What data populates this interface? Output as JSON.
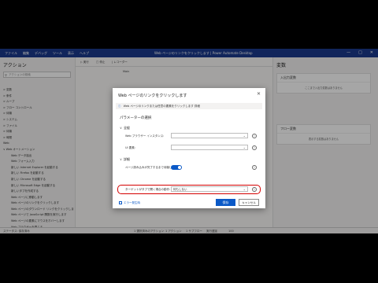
{
  "titlebar": {
    "menu": [
      "ファイル",
      "編集",
      "デバッグ",
      "ツール",
      "表示",
      "ヘルプ"
    ],
    "title": "Web ページのリンクをクリックします | Power Automate Desktop",
    "controls": [
      "—",
      "□",
      "✕"
    ]
  },
  "left_panel": {
    "title": "アクション",
    "search_placeholder": "アクションの検索",
    "items": [
      {
        "label": "> 変数",
        "level": "cat"
      },
      {
        "label": "> 条件",
        "level": "cat"
      },
      {
        "label": "> ループ",
        "level": "cat"
      },
      {
        "label": "> フロー コントロール",
        "level": "cat"
      },
      {
        "label": "> 待機",
        "level": "cat"
      },
      {
        "label": "> システム",
        "level": "cat"
      },
      {
        "label": "> ファイル",
        "level": "cat"
      },
      {
        "label": "> 待機",
        "level": "cat"
      },
      {
        "label": "> 時間",
        "level": "cat"
      },
      {
        "label": "Web",
        "level": "cat"
      },
      {
        "label": "∨ Web オートメーション",
        "level": "cat"
      },
      {
        "label": "Web データ抽出",
        "level": "sub"
      },
      {
        "label": "Web フォーム入力",
        "level": "sub"
      },
      {
        "label": "新しい Internet Explorer を起動する",
        "level": "sub"
      },
      {
        "label": "新しい Firefox を起動する",
        "level": "sub"
      },
      {
        "label": "新しい Chrome を起動する",
        "level": "sub"
      },
      {
        "label": "新しい Microsoft Edge を起動する",
        "level": "sub"
      },
      {
        "label": "新しいタブを作成する",
        "level": "sub"
      },
      {
        "label": "Web ページに移動します",
        "level": "sub"
      },
      {
        "label": "Web ページのリンクをクリックします",
        "level": "sub"
      },
      {
        "label": "Web ページのダウンロード リンクをクリックします",
        "level": "sub"
      },
      {
        "label": "Web ページで JavaScript 関数を実行します",
        "level": "sub"
      },
      {
        "label": "Web ページの要素にマウスをホバーします",
        "level": "sub"
      },
      {
        "label": "Web ブラウザーを閉じる",
        "level": "sub"
      },
      {
        "label": "Excel",
        "level": "cat"
      },
      {
        "label": "> データベース",
        "level": "cat"
      }
    ]
  },
  "center": {
    "toolbar": [
      "▷ 実行",
      "□ 停止",
      "| レコーダー",
      "Main"
    ]
  },
  "right_panel": {
    "title": "変数",
    "input_output": {
      "header": "入出力変数",
      "text": "ここまで入出力変数はありません"
    },
    "flow": {
      "header": "フロー変数",
      "text": "表示する変数はありません"
    }
  },
  "statusbar": {
    "left": "ステータス: 保存済み",
    "mid": [
      "1 選択済みのアクション",
      "1 アクション",
      "1 サブフロー"
    ],
    "right": "実行遅延",
    "delay": "100"
  },
  "dialog": {
    "title": "Web ページのリンクをクリックします",
    "info": "Web ページのリンクまたは任意の要素をクリックします 詳細",
    "params_title": "パラメーターの選択",
    "general_group": "全般",
    "browser_label": "Web ブラウザー インスタンス:",
    "element_label": "UI 要素:",
    "advanced_group": "詳細",
    "wait_label": "ページ読み込みが完了するまで待機します:",
    "new_tab_label": "ターゲットがタブで開く場合の動作:",
    "new_tab_value": "何もしない",
    "error_handling": "エラー発生時",
    "save": "保存",
    "cancel": "キャンセル"
  },
  "colors": {
    "accent": "#0b59c7",
    "titlebar": "#1b3a8c",
    "highlight": "#d40000"
  }
}
